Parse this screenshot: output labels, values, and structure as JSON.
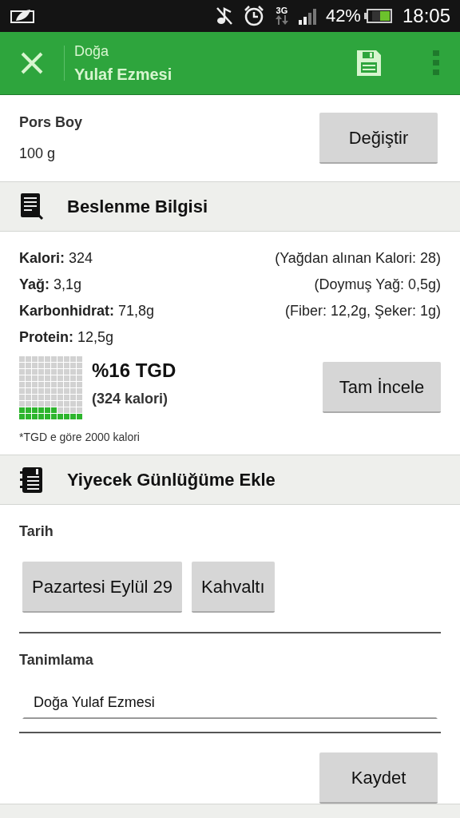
{
  "status_bar": {
    "network": "3G",
    "battery": "42%",
    "time": "18:05"
  },
  "app_bar": {
    "subtitle": "Doğa",
    "title": "Yulaf Ezmesi"
  },
  "serving": {
    "label": "Pors Boy",
    "value": "100 g",
    "button": "Değiştir"
  },
  "nutrition": {
    "title": "Beslenme Bilgisi",
    "rows": [
      {
        "left": "**Kalori:** 324",
        "right": "(Yağdan alınan Kalori: 28)"
      },
      {
        "left": "**Yağ:** 3,1g",
        "right": "(Doymuş Yağ: 0,5g)"
      },
      {
        "left": "**Karbonhidrat:** 71,8g",
        "right": "(Fiber: 12,2g, Şeker: 1g)"
      },
      {
        "left": "**Protein:** 12,5g"
      }
    ],
    "daily": {
      "percent": "%16 TGD",
      "calories": "(324 kalori)"
    },
    "button": "Tam İncele",
    "footnote": "*TGD e göre 2000 kalori"
  },
  "diary": {
    "title": "Yiyecek Günlüğüme Ekle",
    "date_label": "Tarih",
    "date_button": "Pazartesi Eylül 29",
    "meal_button": "Kahvaltı",
    "description_label": "Tanimlama",
    "description_value": "Doğa Yulaf Ezmesi",
    "save_button": "Kaydet"
  }
}
